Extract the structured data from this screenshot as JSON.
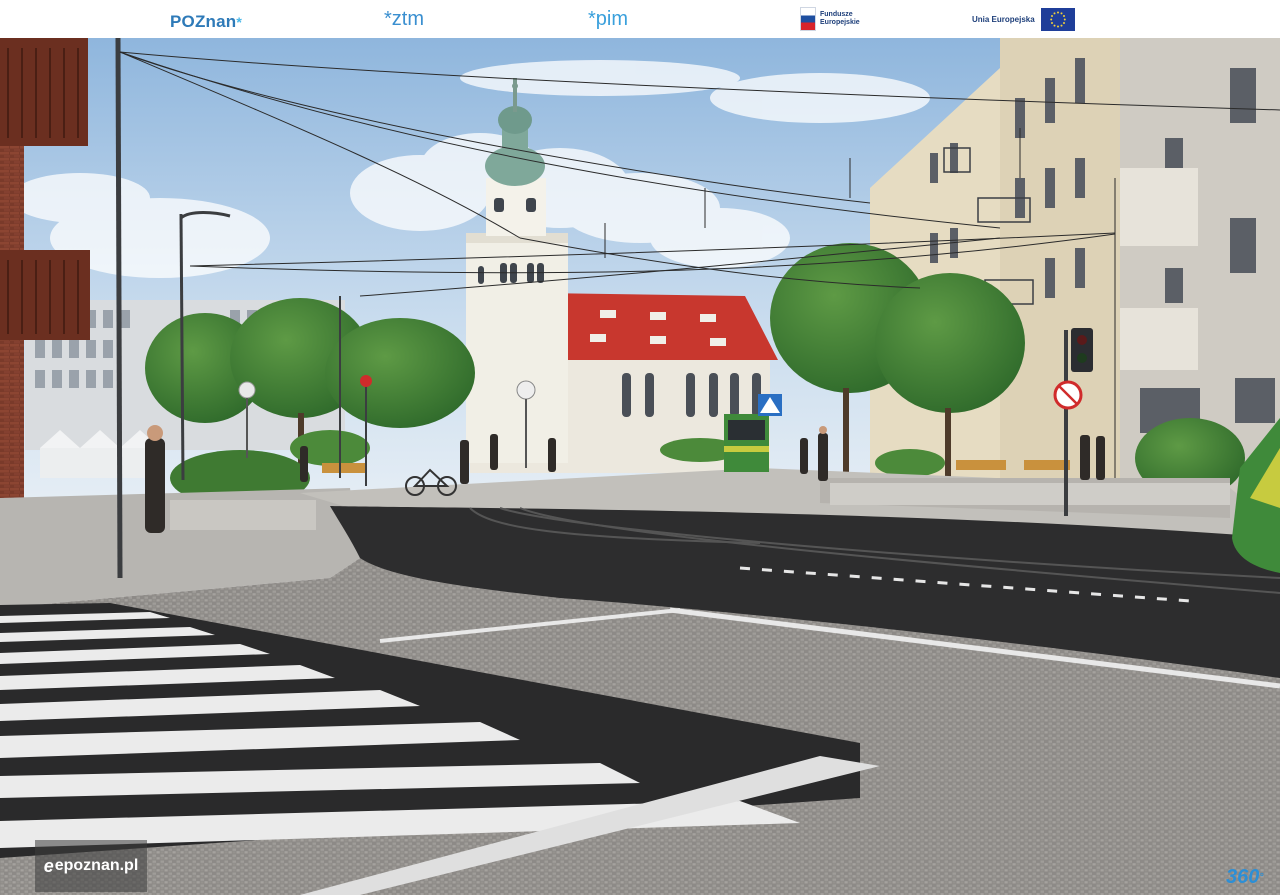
{
  "header": {
    "logos": {
      "poznan": {
        "text": "POZnan",
        "mark": "*"
      },
      "ztm": {
        "text": "*ztm"
      },
      "pim": {
        "text": "*pim"
      },
      "fundusze": {
        "line1": "Fundusze",
        "line2": "Europejskie"
      },
      "ue": {
        "line1": "Unia Europejska"
      }
    }
  },
  "scene": {
    "description_icons": [
      "sky",
      "church-tower",
      "tram",
      "traffic-light",
      "trees",
      "buildings",
      "crosswalk"
    ],
    "colors": {
      "sky": "#a9c8e6",
      "church_roof": "#c8372e",
      "tram": "#3f8a3a",
      "pavement": "#8e8e8e",
      "asphalt": "#2c2c2c"
    }
  },
  "watermarks": {
    "epoznan": "epoznan.pl",
    "logo_360": "360"
  }
}
